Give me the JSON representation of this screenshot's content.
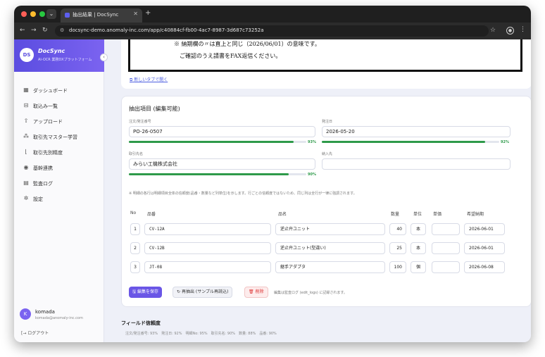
{
  "browser": {
    "tab_title": "抽出結果 | DocSync",
    "url": "docsync-demo.anomaly-inc.com/app/c40884cf-fb00-4ac7-8987-3d687c73252a",
    "colors": {
      "close": "#ff5f57",
      "minimize": "#febc2e",
      "maximize": "#28c840"
    }
  },
  "brand": {
    "logo": "DS",
    "name": "DocSync",
    "subtitle": "AI-OCR 業務DXプラットフォーム",
    "accent": "#5b4de0"
  },
  "sidebar": {
    "items": [
      {
        "icon": "dashboard-icon",
        "label": "ダッシュボード"
      },
      {
        "icon": "inbox-icon",
        "label": "取込み一覧"
      },
      {
        "icon": "upload-icon",
        "label": "アップロード"
      },
      {
        "icon": "hierarchy-icon",
        "label": "取引先マスター学習"
      },
      {
        "icon": "chart-icon",
        "label": "取引先別精度"
      },
      {
        "icon": "plug-icon",
        "label": "基幹連携"
      },
      {
        "icon": "log-icon",
        "label": "監査ログ"
      },
      {
        "icon": "gear-icon",
        "label": "設定"
      }
    ]
  },
  "user": {
    "initial": "K",
    "name": "komada",
    "email": "komada@anomaly-inc.com",
    "logout": "ログアウト"
  },
  "preview": {
    "line1": "※ 納期欄の〃は直上と同じ（2026/06/01）の意味です。",
    "line2": "ご確認のうえ請書をFAX返信ください。",
    "open_new_tab": "新しいタブで開く"
  },
  "extraction": {
    "title": "抽出項目 (編集可能)",
    "fields": {
      "order_no": {
        "label": "注文/発注番号",
        "value": "PO-26-0507",
        "confidence": 93,
        "pct": "93%"
      },
      "order_date": {
        "label": "発注日",
        "value": "2026-05-20",
        "confidence": 92,
        "pct": "92%"
      },
      "vendor": {
        "label": "取引先名",
        "value": "みらい工機株式会社",
        "confidence": 90,
        "pct": "90%"
      },
      "delivery_to": {
        "label": "納入先",
        "value": ""
      }
    },
    "note": "※ 明細の各行は明細項目全体の信頼度(品番・数量など列単位)を示します。行ごとの信頼度ではないため、同じ列は全行が一律に強調されます。",
    "columns": [
      "No",
      "品番",
      "品名",
      "数量",
      "単位",
      "単価",
      "希望納期"
    ],
    "rows": [
      {
        "no": "1",
        "part": "CV-12A",
        "name": "逆止弁ユニット",
        "qty": "40",
        "unit": "本",
        "price": "",
        "due": "2026-06-01"
      },
      {
        "no": "2",
        "part": "CV-12B",
        "name": "逆止弁ユニット(型違い)",
        "qty": "25",
        "unit": "本",
        "price": "",
        "due": "2026-06-01"
      },
      {
        "no": "3",
        "part": "JT-08",
        "name": "継手アダプタ",
        "qty": "100",
        "unit": "個",
        "price": "",
        "due": "2026-06-08"
      }
    ],
    "buttons": {
      "save": "編集を保存",
      "reextract": "再抽出 (サンプル再読込)",
      "delete": "削除"
    },
    "button_note": "編集は監査ログ (edit_logs) に記録されます。"
  },
  "confidence": {
    "title": "フィールド信頼度",
    "summary": "注文/発注番号: 93%　発注日: 92%　明細No: 95%　取引先名: 90%　数量: 88%　品番: 90%"
  }
}
